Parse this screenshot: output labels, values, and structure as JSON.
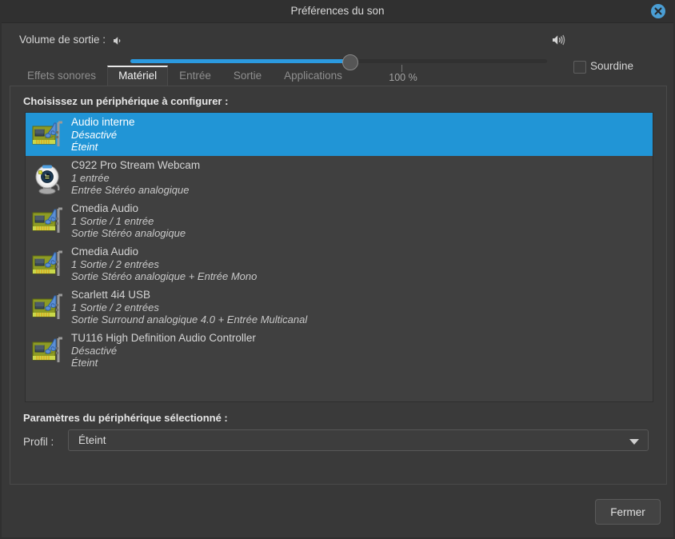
{
  "window": {
    "title": "Préférences du son",
    "close_icon": "close-icon"
  },
  "volume": {
    "label": "Volume de sortie :",
    "low_icon": "speaker-low-icon",
    "high_icon": "speaker-high-icon",
    "tick_label": "100 %",
    "percent": 100,
    "mute_label": "Sourdine",
    "mute_checked": false,
    "fill_color": "#2b9ae0"
  },
  "tabs": [
    {
      "label": "Effets sonores",
      "active": false
    },
    {
      "label": "Matériel",
      "active": true
    },
    {
      "label": "Entrée",
      "active": false
    },
    {
      "label": "Sortie",
      "active": false
    },
    {
      "label": "Applications",
      "active": false
    }
  ],
  "hardware": {
    "choose_label": "Choisissez un périphérique à configurer :",
    "devices": [
      {
        "icon": "sound-card-icon",
        "name": "Audio interne",
        "line2": "Désactivé",
        "line3": "Éteint",
        "selected": true
      },
      {
        "icon": "webcam-icon",
        "name": "C922 Pro Stream Webcam",
        "line2": "1 entrée",
        "line3": "Entrée Stéréo analogique",
        "selected": false
      },
      {
        "icon": "sound-card-icon",
        "name": "Cmedia Audio",
        "line2": "1 Sortie / 1 entrée",
        "line3": "Sortie Stéréo analogique",
        "selected": false
      },
      {
        "icon": "sound-card-icon",
        "name": "Cmedia Audio",
        "line2": "1 Sortie / 2 entrées",
        "line3": "Sortie Stéréo analogique + Entrée Mono",
        "selected": false
      },
      {
        "icon": "sound-card-icon",
        "name": "Scarlett 4i4 USB",
        "line2": "1 Sortie / 2 entrées",
        "line3": "Sortie Surround analogique 4.0 + Entrée Multicanal",
        "selected": false
      },
      {
        "icon": "sound-card-icon",
        "name": "TU116 High Definition Audio Controller",
        "line2": "Désactivé",
        "line3": "Éteint",
        "selected": false
      }
    ],
    "params_label": "Paramètres du périphérique sélectionné :",
    "profil_label": "Profil :",
    "profil_value": "Éteint",
    "profil_arrow_icon": "chevron-down-icon"
  },
  "footer": {
    "close_label": "Fermer"
  },
  "colors": {
    "selection": "#2195d6",
    "accent": "#2b9ae0",
    "window_bg": "#383838",
    "panel_bg": "#3a3a3a",
    "list_bg": "#404040"
  }
}
